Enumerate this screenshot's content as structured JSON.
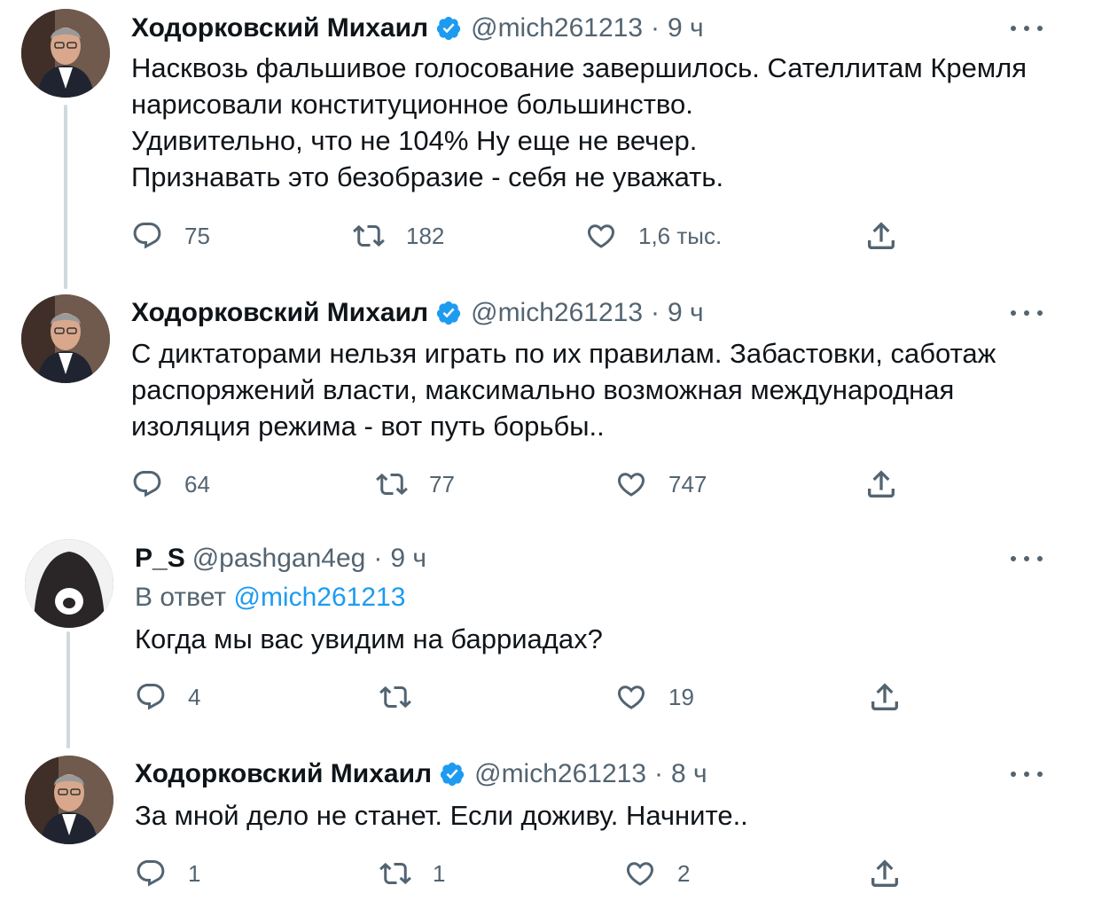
{
  "tweets": [
    {
      "name": "Ходорковский Михаил",
      "verified": true,
      "handle": "@mich261213",
      "separator": "·",
      "time": "9 ч",
      "text": "Насквозь фальшивое голосование завершилось. Сателлитам Кремля\nнарисовали конституционное большинство.\nУдивительно, что не 104% Ну еще не вечер.\nПризнавать это безобразие - себя не уважать.",
      "replies": "75",
      "retweets": "182",
      "likes": "1,6 тыс."
    },
    {
      "name": "Ходорковский Михаил",
      "verified": true,
      "handle": "@mich261213",
      "separator": "·",
      "time": "9 ч",
      "text": "С диктаторами нельзя играть по их правилам. Забастовки, саботаж\nраспоряжений власти, максимально возможная международная\nизоляция режима - вот путь борьбы..",
      "replies": "64",
      "retweets": "77",
      "likes": "747"
    },
    {
      "name": "P_S",
      "verified": false,
      "handle": "@pashgan4eg",
      "separator": "·",
      "time": "9 ч",
      "reply_prefix": "В ответ ",
      "reply_mention": "@mich261213",
      "text": "Когда мы вас увидим на барриадах?",
      "replies": "4",
      "retweets": "",
      "likes": "19"
    },
    {
      "name": "Ходорковский Михаил",
      "verified": true,
      "handle": "@mich261213",
      "separator": "·",
      "time": "8 ч",
      "text": "За мной дело не станет. Если доживу. Начните..",
      "replies": "1",
      "retweets": "1",
      "likes": "2"
    }
  ],
  "colors": {
    "text": "#0f1419",
    "secondary": "#536471",
    "accent": "#1d9bf0",
    "thread_line": "#cfd9de"
  },
  "icons": {
    "verified": "verified-badge-icon",
    "more": "more-options-icon",
    "reply": "reply-icon",
    "retweet": "retweet-icon",
    "like": "like-icon",
    "share": "share-icon"
  }
}
